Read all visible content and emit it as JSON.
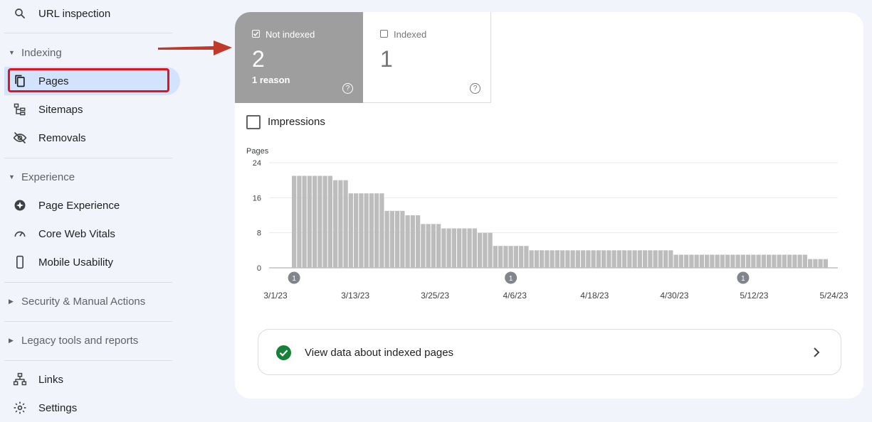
{
  "sidebar": {
    "url_inspection": "URL inspection",
    "sections": {
      "indexing": "Indexing",
      "experience": "Experience",
      "security": "Security & Manual Actions",
      "legacy": "Legacy tools and reports"
    },
    "items": {
      "pages": "Pages",
      "sitemaps": "Sitemaps",
      "removals": "Removals",
      "page_experience": "Page Experience",
      "core_web_vitals": "Core Web Vitals",
      "mobile_usability": "Mobile Usability",
      "links": "Links",
      "settings": "Settings"
    },
    "active_item": "Pages"
  },
  "tiles": {
    "not_indexed": {
      "label": "Not indexed",
      "value": "2",
      "sub": "1 reason",
      "checked": true
    },
    "indexed": {
      "label": "Indexed",
      "value": "1",
      "checked": false
    }
  },
  "impressions": {
    "label": "Impressions",
    "checked": false
  },
  "help_icon_text": "?",
  "chart_data": {
    "type": "bar",
    "ylabel": "Pages",
    "ylim": [
      0,
      24
    ],
    "yticks": [
      "24",
      "16",
      "8",
      "0"
    ],
    "grid": true,
    "x_tick_labels": [
      "3/1/23",
      "3/13/23",
      "3/25/23",
      "4/6/23",
      "4/18/23",
      "4/30/23",
      "5/12/23",
      "5/24/23"
    ],
    "values": [
      21,
      21,
      21,
      21,
      21,
      21,
      21,
      21,
      20,
      20,
      20,
      17,
      17,
      17,
      17,
      17,
      17,
      17,
      13,
      13,
      13,
      13,
      12,
      12,
      12,
      10,
      10,
      10,
      10,
      9,
      9,
      9,
      9,
      9,
      9,
      9,
      8,
      8,
      8,
      5,
      5,
      5,
      5,
      5,
      5,
      5,
      4,
      4,
      4,
      4,
      4,
      4,
      4,
      4,
      4,
      4,
      4,
      4,
      4,
      4,
      4,
      4,
      4,
      4,
      4,
      4,
      4,
      4,
      4,
      4,
      4,
      4,
      4,
      4,
      3,
      3,
      3,
      3,
      3,
      3,
      3,
      3,
      3,
      3,
      3,
      3,
      3,
      3,
      3,
      3,
      3,
      3,
      3,
      3,
      3,
      3,
      3,
      3,
      3,
      3,
      2,
      2,
      2,
      2
    ],
    "annotations": [
      {
        "label": "1",
        "bar_index": 0
      },
      {
        "label": "1",
        "bar_index": 42
      },
      {
        "label": "1",
        "bar_index": 87
      }
    ],
    "bar_color": "#bdbdbd"
  },
  "view_data": {
    "label": "View data about indexed pages"
  },
  "colors": {
    "accent": "#d3e3fd",
    "highlight": "#e0141c",
    "arrow": "#c0392b",
    "success": "#188038",
    "tile_active": "#9e9e9e"
  }
}
